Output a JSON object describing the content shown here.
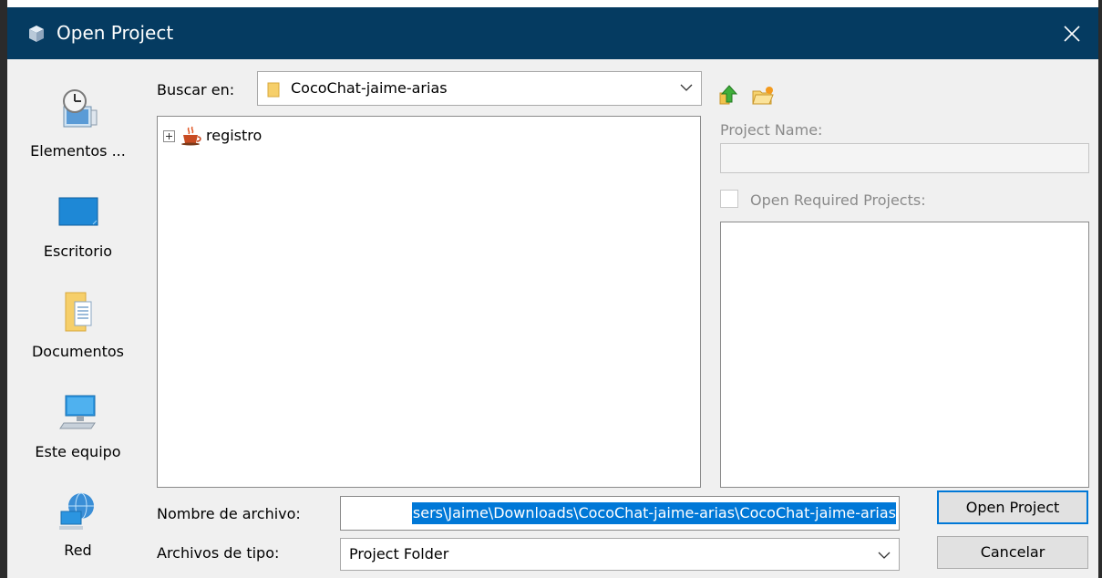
{
  "window": {
    "title": "Open Project",
    "close_icon": "close-icon"
  },
  "places": [
    {
      "label": "Elementos ...",
      "icon": "recent-items-icon"
    },
    {
      "label": "Escritorio",
      "icon": "desktop-icon"
    },
    {
      "label": "Documentos",
      "icon": "documents-folder-icon"
    },
    {
      "label": "Este equipo",
      "icon": "computer-icon"
    },
    {
      "label": "Red",
      "icon": "network-icon"
    }
  ],
  "look_in": {
    "label": "Buscar en:",
    "value": "CocoChat-jaime-arias"
  },
  "toolbar": {
    "up_icon": "up-folder-icon",
    "new_folder_icon": "new-folder-icon"
  },
  "tree": {
    "items": [
      {
        "name": "registro",
        "expanded": false,
        "icon": "java-project-icon"
      }
    ]
  },
  "project_panel": {
    "project_name_label": "Project Name:",
    "project_name_value": "",
    "open_required_label": "Open Required Projects:",
    "open_required_checked": false
  },
  "file_name": {
    "label": "Nombre de archivo:",
    "value": "sers\\Jaime\\Downloads\\CocoChat-jaime-arias\\CocoChat-jaime-arias"
  },
  "file_type": {
    "label": "Archivos de tipo:",
    "value": "Project Folder"
  },
  "buttons": {
    "open": "Open Project",
    "cancel": "Cancelar"
  },
  "colors": {
    "titlebar": "#053b61",
    "selection": "#0078d7",
    "dialog_bg": "#f0f0f0"
  }
}
